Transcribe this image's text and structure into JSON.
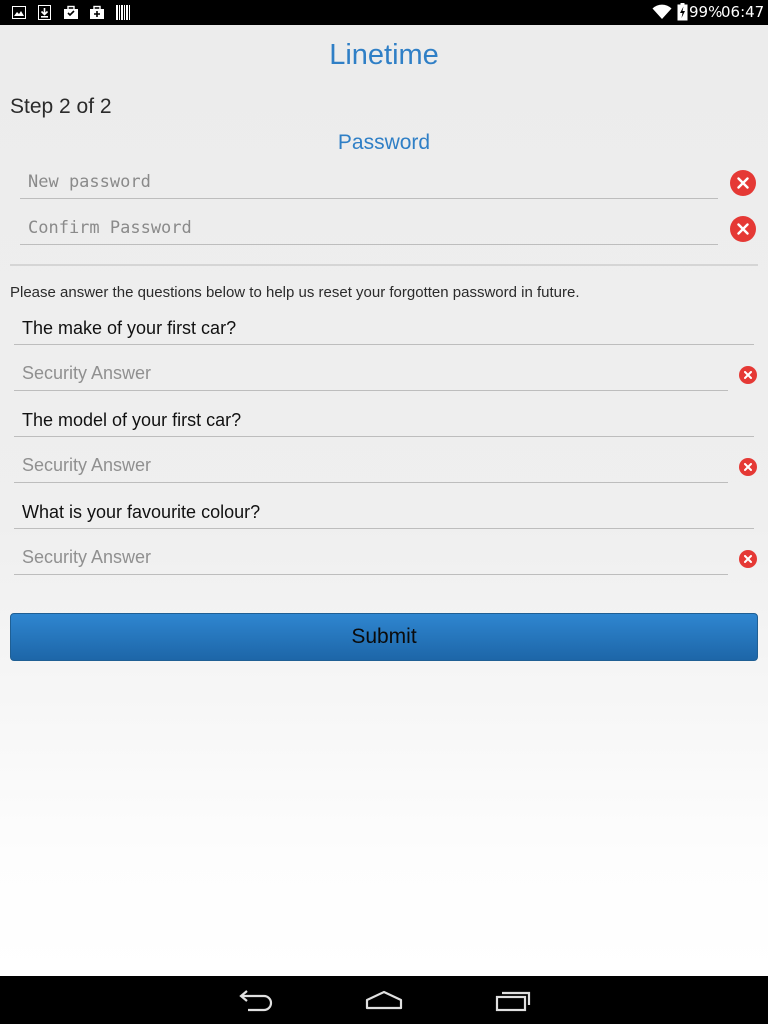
{
  "status_bar": {
    "battery_percent": "99%",
    "time": "06:47",
    "left_icons": [
      "gallery-icon",
      "download-icon",
      "briefcase-icon",
      "briefcase-icon",
      "barcode-icon"
    ],
    "right_icons": [
      "wifi-icon",
      "battery-charging-icon"
    ]
  },
  "header": {
    "app_title": "Linetime",
    "step": "Step 2 of 2",
    "section_title": "Password"
  },
  "password_fields": {
    "new_password": {
      "placeholder": "New password",
      "value": ""
    },
    "confirm_password": {
      "placeholder": "Confirm Password",
      "value": ""
    }
  },
  "security": {
    "instructions": "Please answer the questions below to help us reset your forgotten password in future.",
    "questions": [
      {
        "question": "The make of your first car?",
        "answer_placeholder": "Security Answer"
      },
      {
        "question": "The model of your first car?",
        "answer_placeholder": "Security Answer"
      },
      {
        "question": "What is your favourite colour?",
        "answer_placeholder": "Security Answer"
      }
    ]
  },
  "submit_label": "Submit",
  "colors": {
    "accent": "#2f7fc6",
    "button": "#2676bd",
    "clear_icon": "#e53935"
  },
  "nav_icons": [
    "back-icon",
    "home-icon",
    "recent-apps-icon"
  ]
}
